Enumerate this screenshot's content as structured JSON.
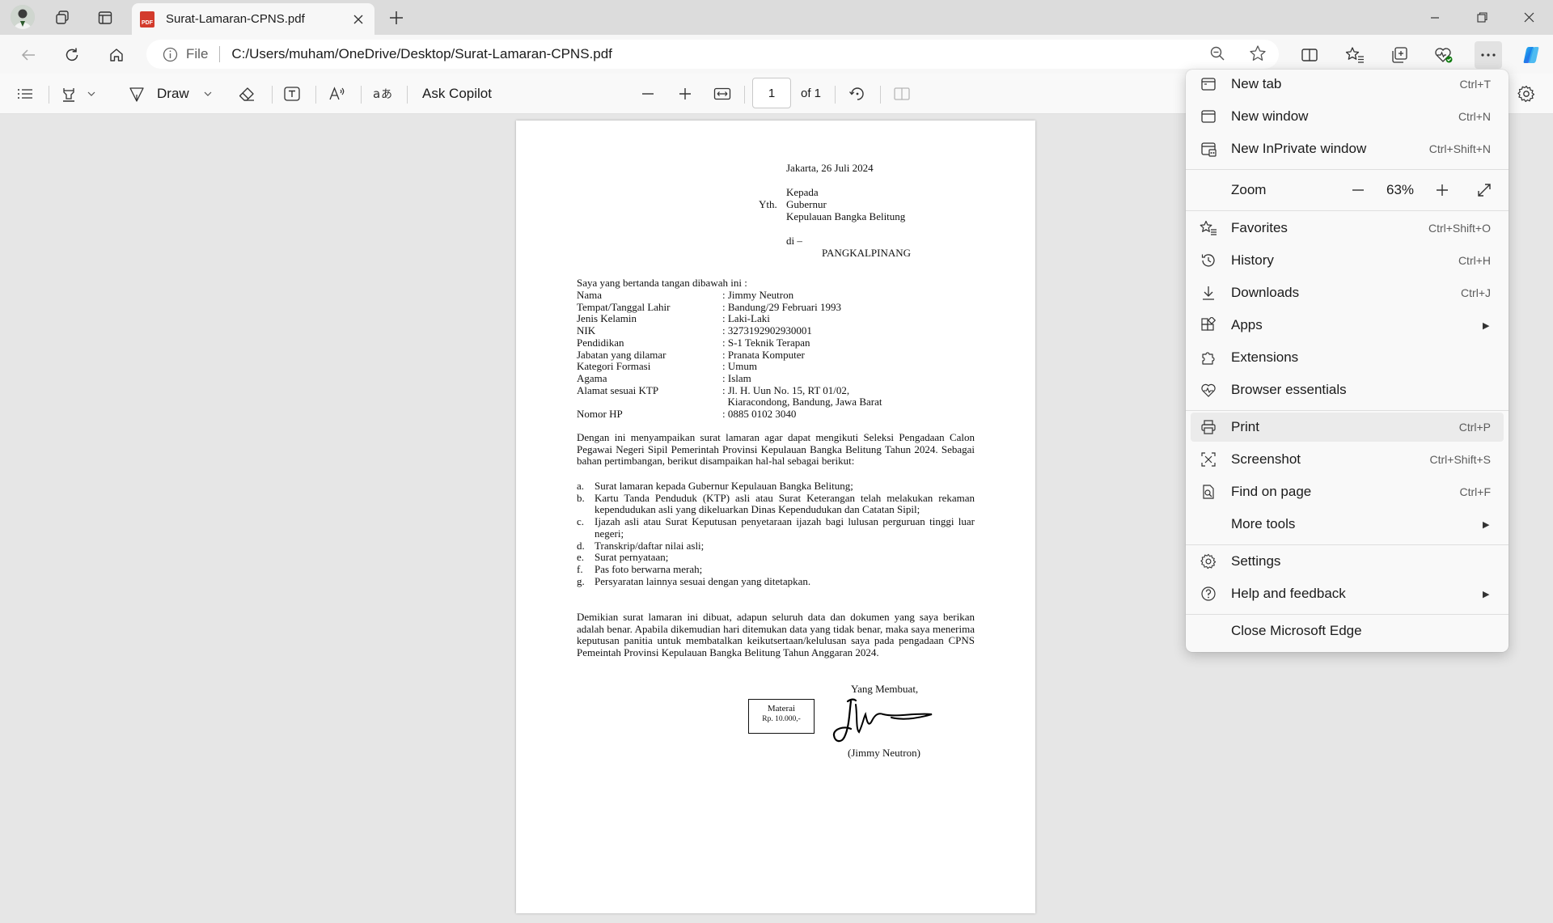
{
  "browser": {
    "tab_title": "Surat-Lamaran-CPNS.pdf",
    "address_label": "File",
    "url": "C:/Users/muham/OneDrive/Desktop/Surat-Lamaran-CPNS.pdf"
  },
  "pdf_toolbar": {
    "draw_label": "Draw",
    "ask_copilot_label": "Ask Copilot",
    "page_number": "1",
    "page_of": "of 1"
  },
  "document": {
    "date": "Jakarta, 26 Juli 2024",
    "kepada": "Kepada",
    "yth": "Yth.",
    "recipient_line1": "Gubernur",
    "recipient_line2": "Kepulauan Bangka Belitung",
    "di": "di –",
    "city": "PANGKALPINANG",
    "intro": "Saya yang bertanda tangan dibawah ini :",
    "fields": [
      {
        "label": "Nama",
        "value": ": Jimmy Neutron"
      },
      {
        "label": "Tempat/Tanggal Lahir",
        "value": ": Bandung/29 Februari 1993"
      },
      {
        "label": "Jenis Kelamin",
        "value": ": Laki-Laki"
      },
      {
        "label": "NIK",
        "value": ": 3273192902930001"
      },
      {
        "label": "Pendidikan",
        "value": ": S-1 Teknik Terapan"
      },
      {
        "label": "Jabatan yang dilamar",
        "value": ": Pranata Komputer"
      },
      {
        "label": "Kategori Formasi",
        "value": ": Umum"
      },
      {
        "label": "Agama",
        "value": ": Islam"
      },
      {
        "label": "Alamat sesuai KTP",
        "value": ": Jl. H. Uun No. 15, RT 01/02,"
      },
      {
        "label": "",
        "value": "  Kiaracondong, Bandung, Jawa Barat"
      },
      {
        "label": "Nomor HP",
        "value": ": 0885 0102 3040"
      }
    ],
    "paragraph1": "Dengan ini menyampaikan surat lamaran agar dapat mengikuti Seleksi Pengadaan Calon Pegawai Negeri Sipil Pemerintah Provinsi Kepulauan Bangka Belitung Tahun 2024. Sebagai bahan pertimbangan, berikut disampaikan hal-hal sebagai berikut:",
    "list": [
      {
        "key": "a.",
        "text": "Surat lamaran kepada Gubernur Kepulauan Bangka Belitung;"
      },
      {
        "key": "b.",
        "text": "Kartu Tanda Penduduk (KTP) asli atau Surat Keterangan telah melakukan rekaman kependudukan asli yang dikeluarkan Dinas Kependudukan dan Catatan Sipil;"
      },
      {
        "key": "c.",
        "text": "Ijazah asli atau Surat Keputusan penyetaraan ijazah bagi lulusan perguruan tinggi luar negeri;"
      },
      {
        "key": "d.",
        "text": "Transkrip/daftar nilai asli;"
      },
      {
        "key": "e.",
        "text": "Surat pernyataan;"
      },
      {
        "key": "f.",
        "text": "Pas foto berwarna merah;"
      },
      {
        "key": "g.",
        "text": "Persyaratan lainnya sesuai dengan yang ditetapkan."
      }
    ],
    "paragraph2": "Demikian surat lamaran ini dibuat, adapun seluruh data dan dokumen yang saya berikan adalah benar. Apabila dikemudian hari ditemukan data yang tidak benar, maka saya menerima keputusan panitia untuk membatalkan keikutsertaan/kelulusan saya pada pengadaan CPNS Pemeintah Provinsi Kepulauan Bangka Belitung Tahun Anggaran 2024.",
    "signoff": "Yang Membuat,",
    "materai_label": "Materai",
    "materai_value": "Rp. 10.000,-",
    "signer": "(Jimmy Neutron)"
  },
  "menu": {
    "items": [
      {
        "label": "New tab",
        "shortcut": "Ctrl+T"
      },
      {
        "label": "New window",
        "shortcut": "Ctrl+N"
      },
      {
        "label": "New InPrivate window",
        "shortcut": "Ctrl+Shift+N"
      },
      {
        "label": "Favorites",
        "shortcut": "Ctrl+Shift+O"
      },
      {
        "label": "History",
        "shortcut": "Ctrl+H"
      },
      {
        "label": "Downloads",
        "shortcut": "Ctrl+J"
      },
      {
        "label": "Apps",
        "shortcut": ""
      },
      {
        "label": "Extensions",
        "shortcut": ""
      },
      {
        "label": "Browser essentials",
        "shortcut": ""
      },
      {
        "label": "Print",
        "shortcut": "Ctrl+P"
      },
      {
        "label": "Screenshot",
        "shortcut": "Ctrl+Shift+S"
      },
      {
        "label": "Find on page",
        "shortcut": "Ctrl+F"
      },
      {
        "label": "More tools",
        "shortcut": ""
      },
      {
        "label": "Settings",
        "shortcut": ""
      },
      {
        "label": "Help and feedback",
        "shortcut": ""
      },
      {
        "label": "Close Microsoft Edge",
        "shortcut": ""
      }
    ],
    "zoom_label": "Zoom",
    "zoom_value": "63%"
  }
}
